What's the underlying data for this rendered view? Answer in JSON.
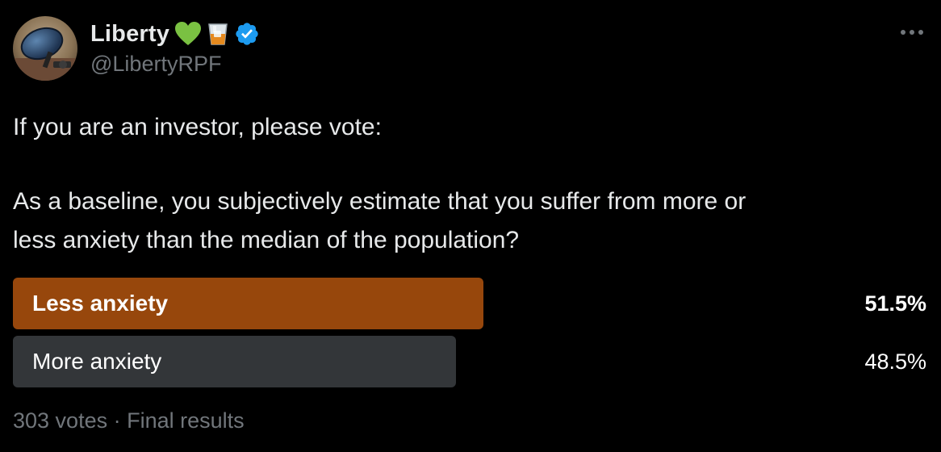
{
  "author": {
    "display_name": "Liberty",
    "handle": "@LibertyRPF",
    "verified": true,
    "name_emojis": [
      "green-heart-icon",
      "whisky-glass-icon"
    ]
  },
  "tweet": {
    "text_line_1": "If you are an investor, please vote:",
    "text_line_2": "As a baseline, you subjectively estimate that you suffer from more or",
    "text_line_3": "less anxiety than the median of the population?"
  },
  "poll": {
    "options": [
      {
        "label": "Less anxiety",
        "percent_text": "51.5%",
        "percent": 51.5,
        "winner": true
      },
      {
        "label": "More anxiety",
        "percent_text": "48.5%",
        "percent": 48.5,
        "winner": false
      }
    ],
    "votes": "303 votes",
    "separator": "·",
    "status": "Final results"
  },
  "colors": {
    "background": "#000000",
    "winner_bar": "#97470c",
    "other_bar": "#333639",
    "verified_badge": "#1d9bf0",
    "heart": "#7ac142",
    "muted_text": "#71767b"
  }
}
